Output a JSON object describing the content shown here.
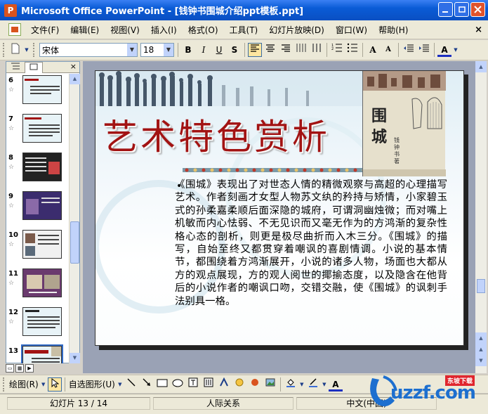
{
  "window": {
    "title": "Microsoft Office PowerPoint - [钱钟书围城介绍ppt模板.ppt]",
    "app_icon_glyph": "P"
  },
  "menu": {
    "items": [
      "文件(F)",
      "编辑(E)",
      "视图(V)",
      "插入(I)",
      "格式(O)",
      "工具(T)",
      "幻灯片放映(D)",
      "窗口(W)",
      "帮助(H)"
    ],
    "close_glyph": "×"
  },
  "toolbar": {
    "font_name": "宋体",
    "font_size": "18",
    "bold": "B",
    "italic": "I",
    "underline": "U",
    "shadow": "S",
    "grow_font": "A",
    "shrink_font": "A",
    "font_color": "A"
  },
  "outline_pane": {
    "slides": [
      {
        "number": "6"
      },
      {
        "number": "7"
      },
      {
        "number": "8"
      },
      {
        "number": "9"
      },
      {
        "number": "10"
      },
      {
        "number": "11"
      },
      {
        "number": "12"
      },
      {
        "number": "13"
      }
    ],
    "star_glyph": "☆",
    "close_glyph": "×"
  },
  "slide": {
    "title": "艺术特色赏析",
    "book_char_top": "围",
    "book_char_bottom": "城",
    "book_author": "钱钟书著",
    "bullet": "•",
    "body": "《围城》表现出了对世态人情的精微观察与高超的心理描写艺术。作者刻画才女型人物苏文纨的矜持与矫情，小家碧玉式的孙柔嘉柔顺后面深隐的城府，可谓洞幽烛微；而对嘴上机敏而内心怯弱、不无见识而又毫无作为的方鸿渐的复杂性格心态的剖析，则更是极尽曲折而入木三分。《围城》的描写，自始至终又都贯穿着嘲讽的喜剧情调。小说的基本情节，都围绕着方鸿渐展开，小说的诸多人物，场面也大都从方的观点展现，方的观人阅世的揶揄态度，以及隐含在他背后的小说作者的嘲讽口吻，交错交融，使《围城》的讽刺手法别具一格。"
  },
  "drawing_toolbar": {
    "draw_label": "绘图(R)",
    "autoshapes_label": "自选图形(U)"
  },
  "status": {
    "slide_info": "幻灯片 13 / 14",
    "design": "人际关系",
    "language": "中文(中国)"
  },
  "watermark": {
    "text": "uzzf.com",
    "badge": "东坡下载"
  },
  "colors": {
    "title_red": "#a21313",
    "titlebar_blue": "#0a5bd6",
    "watermark_blue": "#1d6fcf"
  }
}
